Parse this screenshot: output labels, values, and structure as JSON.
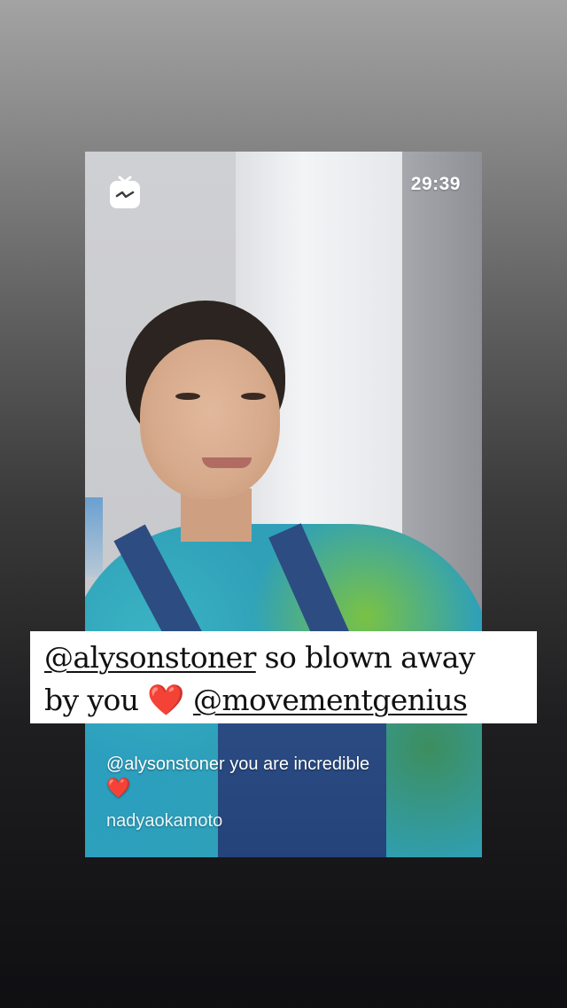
{
  "story": {
    "timer": "29:39"
  },
  "caption": {
    "mention_1": "@alysonstoner",
    "text_1": " so blown away",
    "text_2": "by you ",
    "heart": "❤️",
    "mention_2": "@movementgenius"
  },
  "comment": {
    "text": "@alysonstoner you are incredible",
    "heart": "❤️",
    "username": "nadyaokamoto"
  },
  "icons": {
    "app_logo": "igtv-icon"
  },
  "colors": {
    "heart": "#e8202a",
    "caption_bg": "#ffffff"
  }
}
